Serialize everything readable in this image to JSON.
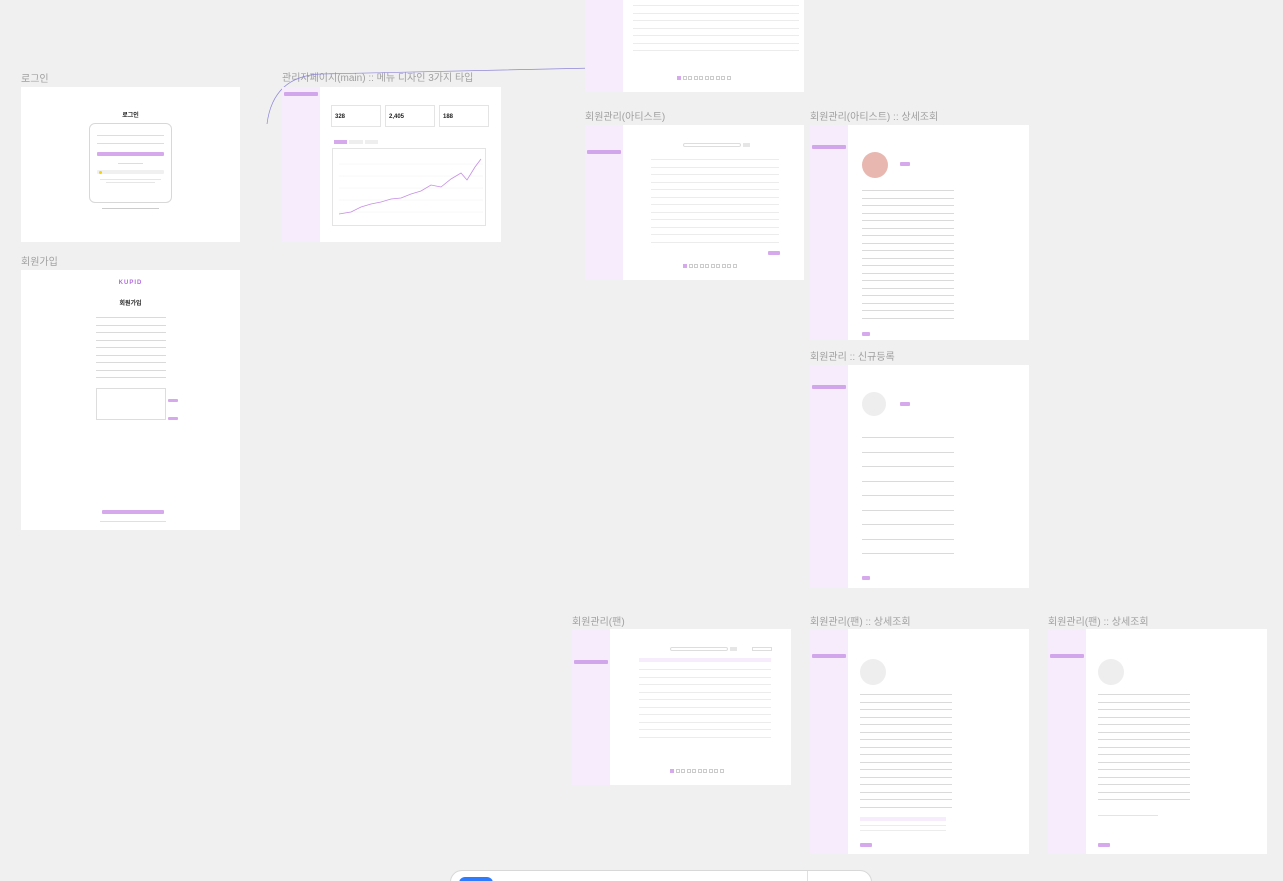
{
  "frames": {
    "login": "로그인",
    "signup": "회원가입",
    "admin_main": "관리자페이지(main) :: 메뉴 디자인 3가지 타입",
    "artist_list": "회원관리(아티스트)",
    "artist_detail": "회원관리(아티스트) :: 상세조회",
    "artist_new": "회원관리 :: 신규등록",
    "fan_list": "회원관리(팬)",
    "fan_detail_a": "회원관리(팬) :: 상세조회",
    "fan_detail_b": "회원관리(팬) :: 상세조회"
  },
  "login": {
    "title": "로그인"
  },
  "signup": {
    "logo": "KUPID",
    "title": "회원가입"
  },
  "dashboard": {
    "stats": [
      "328",
      "2,405",
      "188"
    ]
  },
  "colors": {
    "accent": "#d6a8ec",
    "sidebar": "#f6ecfb",
    "canvas": "#f0f0f0"
  }
}
